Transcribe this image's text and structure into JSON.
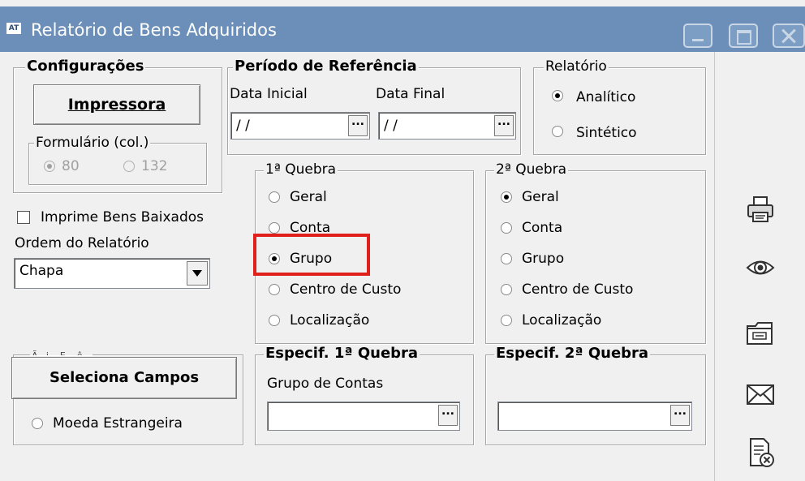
{
  "window": {
    "app_icon": "AT",
    "title": "Relatório de Bens Adquiridos"
  },
  "configuracoes": {
    "legend": "Configurações",
    "printer_button": "Impressora",
    "formulario": {
      "legend": "Formulário (col.)",
      "options": [
        "80",
        "132"
      ],
      "selected": "80"
    }
  },
  "imprime_baixados": {
    "label": "Imprime Bens Baixados",
    "checked": false
  },
  "ordem": {
    "label": "Ordem do Relatório",
    "value": "Chapa"
  },
  "periodo": {
    "legend": "Período de Referência",
    "data_inicial_label": "Data Inicial",
    "data_final_label": "Data Final",
    "data_inicial_value": "/ /",
    "data_final_value": "/ /",
    "ellipsis": "..."
  },
  "relatorio": {
    "legend": "Relatório",
    "options": [
      "Analítico",
      "Sintético"
    ],
    "selected": "Analítico"
  },
  "quebra1": {
    "legend": "1ª Quebra",
    "options": [
      "Geral",
      "Conta",
      "Grupo",
      "Centro de Custo",
      "Localização"
    ],
    "selected": "Grupo",
    "highlight": "#e0201a"
  },
  "quebra2": {
    "legend": "2ª Quebra",
    "options": [
      "Geral",
      "Conta",
      "Grupo",
      "Centro de Custo",
      "Localização"
    ],
    "selected": "Geral"
  },
  "especif1": {
    "legend": "Especif. 1ª Quebra",
    "field_label": "Grupo de Contas",
    "value": ""
  },
  "especif2": {
    "legend": "Especif. 2ª Quebra",
    "value": ""
  },
  "lower_left": {
    "partial_legend": "Ã...i... E....ê...",
    "button": "Seleciona Campos",
    "moeda_label": "Moeda Estrangeira"
  },
  "sidebar_icons": [
    "printer-icon",
    "preview-eye-icon",
    "export-icon",
    "email-icon",
    "close-report-icon"
  ],
  "colors": {
    "titlebar": "#6b8fb8",
    "background": "#f0f0f0",
    "highlight": "#e0201a"
  }
}
